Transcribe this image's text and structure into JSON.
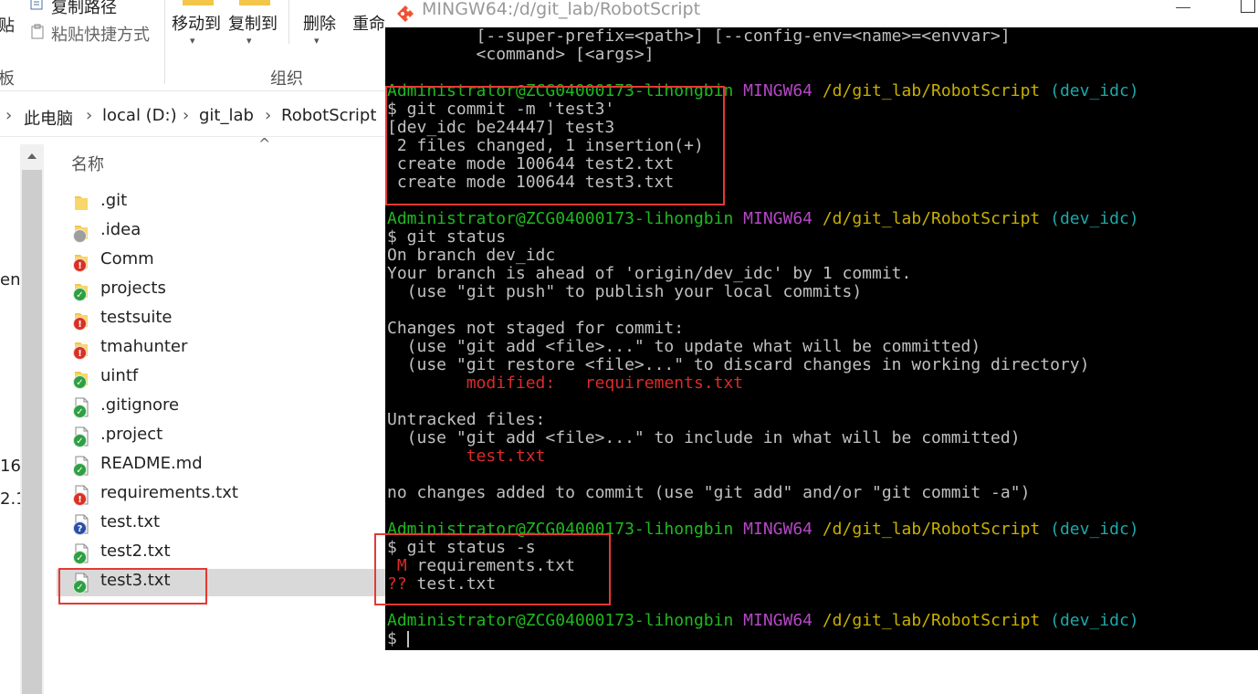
{
  "explorer": {
    "ribbon": {
      "copy_path": "复制路径",
      "paste_shortcut": "粘贴快捷方式",
      "paste_cut": "贴",
      "clipboard_cut": "板",
      "move_to": "移动到",
      "copy_to": "复制到",
      "delete": "删除",
      "rename": "重命",
      "group_organize": "组织"
    },
    "breadcrumb": [
      "此电脑",
      "local (D:)",
      "git_lab",
      "RobotScript"
    ],
    "left_cut_labels": [
      "en",
      "16.",
      "2.1"
    ],
    "column_header": "名称",
    "files": [
      {
        "name": ".git",
        "type": "folder",
        "status": "none"
      },
      {
        "name": ".idea",
        "type": "folder",
        "status": "ignored"
      },
      {
        "name": "Comm",
        "type": "folder",
        "status": "modified"
      },
      {
        "name": "projects",
        "type": "folder",
        "status": "ok"
      },
      {
        "name": "testsuite",
        "type": "folder",
        "status": "modified"
      },
      {
        "name": "tmahunter",
        "type": "folder",
        "status": "modified"
      },
      {
        "name": "uintf",
        "type": "folder",
        "status": "ok"
      },
      {
        "name": ".gitignore",
        "type": "file",
        "status": "ok"
      },
      {
        "name": ".project",
        "type": "file",
        "status": "ok"
      },
      {
        "name": "README.md",
        "type": "file",
        "status": "ok"
      },
      {
        "name": "requirements.txt",
        "type": "file",
        "status": "modified"
      },
      {
        "name": "test.txt",
        "type": "file",
        "status": "unversioned"
      },
      {
        "name": "test2.txt",
        "type": "file",
        "status": "ok"
      },
      {
        "name": "test3.txt",
        "type": "file",
        "status": "ok"
      }
    ]
  },
  "terminal": {
    "title": "MINGW64:/d/git_lab/RobotScript",
    "prompt": {
      "user": "Administrator@ZCG04000173-lihongbin",
      "env": "MINGW64",
      "path": "/d/git_lab/RobotScript",
      "branch": "(dev_idc)"
    },
    "lines": {
      "usage1": "         [--super-prefix=<path>] [--config-env=<name>=<envvar>]",
      "usage2": "         <command> [<args>]",
      "cmd_commit": "$ git commit -m 'test3'",
      "commit_out1": "[dev_idc be24447] test3",
      "commit_out2": " 2 files changed, 1 insertion(+)",
      "commit_out3": " create mode 100644 test2.txt",
      "commit_out4": " create mode 100644 test3.txt",
      "cmd_status": "$ git status",
      "status1": "On branch dev_idc",
      "status2": "Your branch is ahead of 'origin/dev_idc' by 1 commit.",
      "status3": "  (use \"git push\" to publish your local commits)",
      "status4": "Changes not staged for commit:",
      "status5": "  (use \"git add <file>...\" to update what will be committed)",
      "status6": "  (use \"git restore <file>...\" to discard changes in working directory)",
      "status7_indent": "        ",
      "status7": "modified:   requirements.txt",
      "status8": "Untracked files:",
      "status9": "  (use \"git add <file>...\" to include in what will be committed)",
      "status10_indent": "        ",
      "status10": "test.txt",
      "status11": "no changes added to commit (use \"git add\" and/or \"git commit -a\")",
      "cmd_status_s": "$ git status -s",
      "short1_flag": " M",
      "short1_file": " requirements.txt",
      "short2_flag": "??",
      "short2_file": " test.txt",
      "final_prompt": "$ "
    }
  },
  "colors": {
    "prompt_user": "#1fb91f",
    "prompt_env": "#b548c6",
    "prompt_path": "#c8b000",
    "prompt_branch": "#1ea8a8",
    "error_red": "#dd2a2a",
    "highlight_box": "#e53935"
  }
}
